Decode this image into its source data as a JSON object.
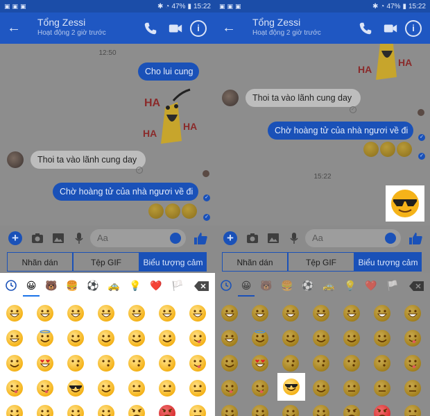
{
  "status": {
    "battery": "47%",
    "time": "15:22"
  },
  "contact": {
    "name": "Tổng Zessi",
    "status": "Hoạt động 2 giờ trước"
  },
  "chat_left": {
    "time": "12:50",
    "msg1": "Cho lui cung",
    "msg2": "Thoi ta vào lãnh cung day",
    "msg3": "Chờ hoàng tử của nhà ngươi về đi"
  },
  "chat_right": {
    "msg2": "Thoi ta vào lãnh cung day",
    "msg3": "Chờ hoàng tử của nhà ngươi về đi",
    "time": "15:22"
  },
  "composer": {
    "placeholder": "Aa"
  },
  "tabs": [
    {
      "label": "Nhãn dán"
    },
    {
      "label": "Tệp GIF"
    },
    {
      "label": "Biểu tượng cảm ..."
    }
  ],
  "tabs_right": [
    {
      "label": "Nhãn dán"
    },
    {
      "label": "Tệp GIF"
    },
    {
      "label": "Biểu tượng cảm ..."
    }
  ],
  "sticker_text": "HA",
  "categories": [
    "recent-icon",
    "smiley-icon",
    "bear-icon",
    "burger-icon",
    "soccer-icon",
    "car-icon",
    "bulb-icon",
    "heart-icon",
    "flag-icon"
  ],
  "colors": {
    "accent": "#1a51b8",
    "emoji": "#f5b319"
  }
}
